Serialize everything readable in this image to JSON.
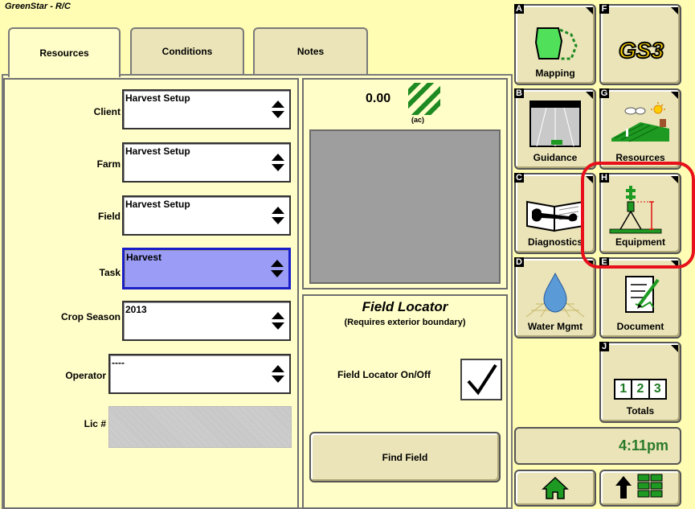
{
  "app": {
    "title": "GreenStar - R/C"
  },
  "tabs": [
    {
      "label": "Resources",
      "active": true
    },
    {
      "label": "Conditions",
      "active": false
    },
    {
      "label": "Notes",
      "active": false
    }
  ],
  "resources": {
    "client": {
      "label": "Client",
      "value": "Harvest Setup"
    },
    "farm": {
      "label": "Farm",
      "value": "Harvest Setup"
    },
    "field": {
      "label": "Field",
      "value": "Harvest Setup"
    },
    "task": {
      "label": "Task",
      "value": "Harvest"
    },
    "crop_season": {
      "label": "Crop Season",
      "value": "2013"
    },
    "operator": {
      "label": "Operator",
      "value": "----"
    },
    "lic": {
      "label": "Lic #"
    }
  },
  "area": {
    "value": "0.00",
    "unit": "(ac)"
  },
  "field_locator": {
    "title": "Field Locator",
    "subtitle": "(Requires exterior boundary)",
    "toggle_label": "Field Locator On/Off",
    "enabled": true,
    "find_button": "Find Field"
  },
  "side_tiles": {
    "a": {
      "letter": "A",
      "label": "Mapping",
      "icon": "mapping-icon"
    },
    "f": {
      "letter": "F",
      "label": "GS3",
      "icon": "gs3-logo"
    },
    "b": {
      "letter": "B",
      "label": "Guidance",
      "icon": "guidance-icon"
    },
    "g": {
      "letter": "G",
      "label": "Resources",
      "icon": "resources-icon"
    },
    "c": {
      "letter": "C",
      "label": "Diagnostics",
      "icon": "diagnostics-icon"
    },
    "h": {
      "letter": "H",
      "label": "Equipment",
      "icon": "equipment-icon"
    },
    "d": {
      "letter": "D",
      "label": "Water Mgmt",
      "icon": "water-icon"
    },
    "e": {
      "letter": "E",
      "label": "Document",
      "icon": "document-icon"
    },
    "j": {
      "letter": "J",
      "label": "Totals",
      "icon": "totals-icon",
      "digits": [
        "1",
        "2",
        "3"
      ]
    }
  },
  "clock": {
    "time": "4:11pm"
  },
  "colors": {
    "background": "#fffdb4",
    "jd_green": "#1e9a22",
    "highlight_ring": "#e8101a",
    "task_selected": "#9a9cf6"
  }
}
